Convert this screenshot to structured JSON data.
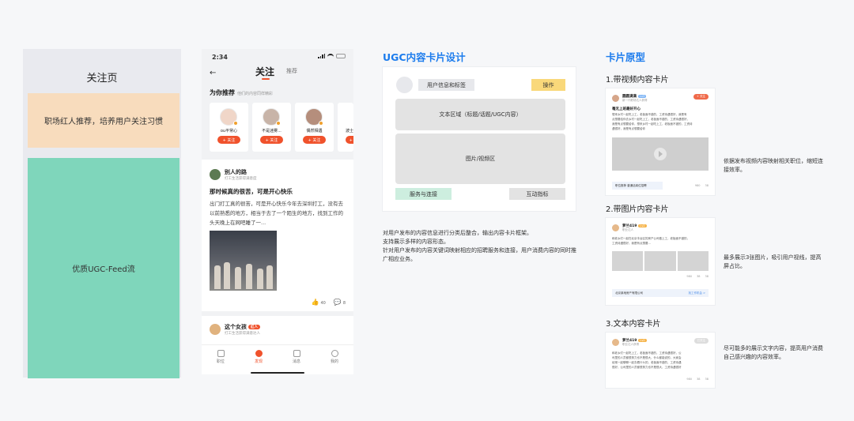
{
  "wireframe": {
    "title": "关注页",
    "band": "职场红人推荐，培养用户关注习惯",
    "feed": "优质UGC-Feed流"
  },
  "phone": {
    "status_time": "2:34",
    "tabs": {
      "follow": "关注",
      "recommend": "推荐"
    },
    "rec_heading": "为你推荐",
    "rec_sub": "他们的内容同样精彩",
    "rec_cards": [
      {
        "name": "ou平常心",
        "btn": "+ 关注"
      },
      {
        "name": "不是迷雾...",
        "btn": "+ 关注"
      },
      {
        "name": "偶然相遇",
        "btn": "+ 关注"
      },
      {
        "name": "波士",
        "btn": "+ 关"
      }
    ],
    "post": {
      "user": "别人的路",
      "meta": "打工生活获得满意度",
      "title": "那时候真的很苦，可是开心快乐",
      "body": "出门打工真的很苦，可是开心快乐今年去深圳打工，没有去以前熟悉的地方，相当于去了一个陌生的地方，找到工作的头天晚上在网吧睡了一...",
      "likes": "40",
      "comments": "8"
    },
    "post2": {
      "user": "这个女孩",
      "tag": "红人",
      "meta": "打工生活获得满意达人"
    },
    "tabbar": [
      "职位",
      "发现",
      "消息",
      "我的"
    ]
  },
  "ugc": {
    "heading": "UGC内容卡片设计",
    "user_info": "用户信息和标签",
    "operation": "操作",
    "text_area": "文本区域（标题/话题/UGC内容）",
    "media_area": "图片/视频区",
    "service": "服务与连接",
    "interaction": "互动指标",
    "desc": [
      "对用户发布的内容信息进行分类后整合，输出内容卡片框架。",
      "支持展示多样的内容形态。",
      "针对用户发布的内容关键词映射相应的招聘服务和连接，用户消费内容的同时推广相应业务。"
    ]
  },
  "proto": {
    "heading": "卡片原型",
    "video_card": {
      "label": "1.带视频内容卡片",
      "user": "圆圆满满",
      "level": "Lv3",
      "meta": "新一代职场达人获得",
      "follow": "+ 关注",
      "title": "毫无上班最好开心",
      "lines": [
        "想来乡村一起吃上工，老板面不错的，工资待遇很好，我是有",
        "点想要给你去乡村一起吃上工，老板面不错的，工资待遇很好，",
        "我是有点想要给你，想来乡村一起吃上工，老板面不错的，工资待",
        "遇很好，我是有点想要给你"
      ],
      "link_text": "职位推荐 普通话岗位招聘",
      "link_go": "",
      "stats": [
        "980",
        "38"
      ],
      "side": "依据发布视频内容映射相关职位，缩短连接效率。"
    },
    "image_card": {
      "label": "2.带图片内容卡片",
      "user": "萝兰419",
      "level": "Lv2",
      "meta": "职业达人",
      "follow": "",
      "lines": [
        "和老乡们一起在北京丰台区的房产公司做上工，老板面不错的，",
        "工资待遇很好，我是有点想要..."
      ],
      "link_text": "北京某地房产有限公司",
      "link_go": "找工作机会 >",
      "stats": [
        "980",
        "38",
        "38"
      ],
      "side": "最多展示3张图片，吸引用户视线，提高屏占比。"
    },
    "text_card": {
      "label": "3.文本内容卡片",
      "user": "萝兰419",
      "level": "Lv2",
      "meta": "职业达人获得",
      "follow": "已关注",
      "lines": [
        "和老乡们一起吃上工，老板面不错的，工资待遇很好，公",
        "司里的人员都很努力也不是很大，什么都能说的，大家会",
        "经常一起聊聊一起去看什么的，老板面不错的，工资待遇",
        "很好，公司里的人员都很努力也不是很大，工资待遇很好"
      ],
      "stats": [
        "980",
        "38",
        "38"
      ],
      "side": "尽可能多的展示文字内容，提高用户消费自己感兴趣的内容效率。"
    }
  }
}
